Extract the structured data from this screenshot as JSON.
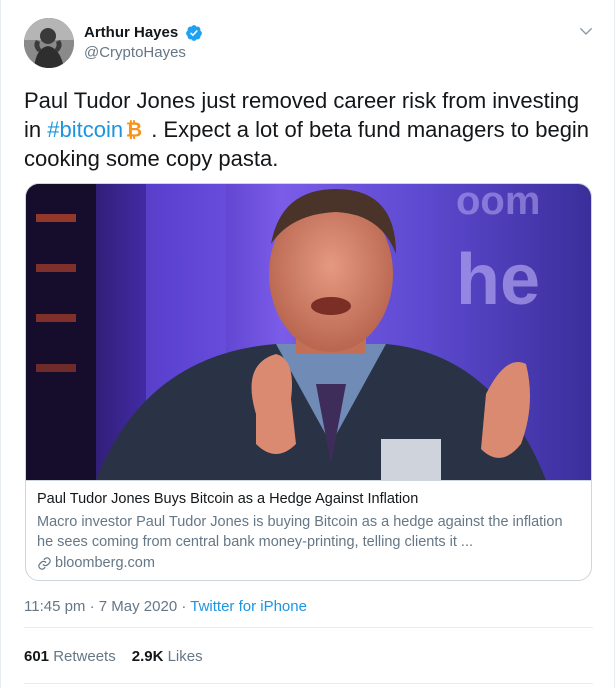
{
  "user": {
    "display_name": "Arthur Hayes",
    "handle": "@CryptoHayes",
    "verified_icon": "verified-badge-icon"
  },
  "tweet": {
    "text_part1": "Paul Tudor Jones just removed career risk from investing in ",
    "hashtag": "#bitcoin",
    "text_part2": " . Expect a lot of beta fund managers to begin cooking some copy pasta."
  },
  "card": {
    "image_alt": "Photo of Paul Tudor Jones speaking",
    "title": "Paul Tudor Jones Buys Bitcoin as a Hedge Against Inflation",
    "description": "Macro investor Paul Tudor Jones is buying Bitcoin as a hedge against the inflation he sees coming from central bank money-printing, telling clients it ...",
    "domain": "bloomberg.com"
  },
  "meta": {
    "time": "11:45 pm",
    "separator": " · ",
    "date": "7 May 2020",
    "source": "Twitter for iPhone"
  },
  "stats": {
    "retweets_count": "601",
    "retweets_label": " Retweets",
    "likes_count": "2.9K",
    "likes_label": " Likes"
  },
  "colors": {
    "link_blue": "#1b95e0",
    "text_primary": "#14171a",
    "text_secondary": "#657786",
    "bitcoin_orange": "#f7931a",
    "border": "#e6ecf0"
  }
}
